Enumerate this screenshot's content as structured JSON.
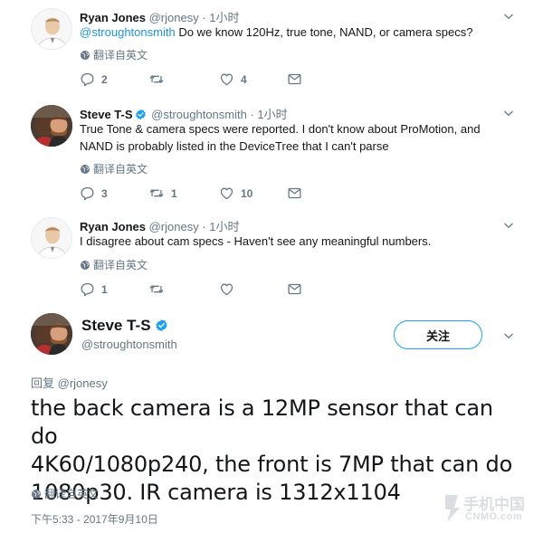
{
  "tweets": [
    {
      "name": "Ryan Jones",
      "handle": "@rjonesy",
      "time": "· 1小时",
      "mention": "@stroughtonsmith",
      "text": "Do we know 120Hz, true tone, NAND, or camera specs?",
      "translate": "翻译自英文",
      "replies": "2",
      "retweets": "",
      "likes": "4"
    },
    {
      "name": "Steve T-S",
      "handle": "@stroughtonsmith",
      "time": "· 1小时",
      "line1": "True Tone & camera specs were reported. I don't know about ProMotion, and",
      "line2": "NAND is probably listed in the DeviceTree that I can't parse",
      "translate": "翻译自英文",
      "replies": "3",
      "retweets": "1",
      "likes": "10"
    },
    {
      "name": "Ryan Jones",
      "handle": "@rjonesy",
      "time": "· 1小时",
      "text": "I disagree about cam specs - Haven't see any meaningful numbers.",
      "translate": "翻译自英文",
      "replies": "1",
      "retweets": "",
      "likes": ""
    }
  ],
  "main_tweet": {
    "name": "Steve T-S",
    "handle": "@stroughtonsmith",
    "follow_label": "关注",
    "reply_to_prefix": "回复",
    "reply_to_handle": "@rjonesy",
    "line1": "the back camera is a 12MP sensor that can do",
    "line2": "4K60/1080p240, the front is 7MP that can do",
    "line3": "1080p30. IR camera is 1312x1104",
    "translate": "翻译自英文",
    "timestamp": "下午5:33 - 2017年9月10日"
  },
  "watermark": {
    "line1": "手机中国",
    "line2": "CNMO.com"
  },
  "colors": {
    "accent": "#1da1f2",
    "link": "#1b95e0",
    "muted": "#657786",
    "text": "#14171a"
  },
  "icons": [
    "reply-icon",
    "retweet-icon",
    "like-icon",
    "message-icon",
    "globe-icon",
    "chevron-down-icon",
    "verified-icon"
  ]
}
